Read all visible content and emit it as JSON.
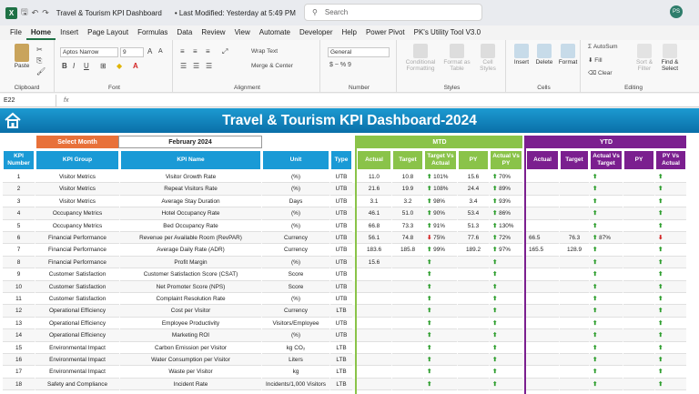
{
  "window": {
    "title": "Travel & Tourism KPI Dashboard",
    "modified": "• Last Modified: Yesterday at 5:49 PM",
    "search_placeholder": "Search",
    "user_initials": "PS"
  },
  "menu": [
    "File",
    "Home",
    "Insert",
    "Page Layout",
    "Formulas",
    "Data",
    "Review",
    "View",
    "Automate",
    "Developer",
    "Help",
    "Power Pivot",
    "PK's Utility Tool V3.0"
  ],
  "ribbon": {
    "clipboard": {
      "label": "Clipboard",
      "paste": "Paste"
    },
    "font": {
      "label": "Font",
      "family": "Aptos Narrow",
      "size": "9",
      "bold": "B",
      "italic": "I",
      "underline": "U"
    },
    "alignment": {
      "label": "Alignment",
      "wrap": "Wrap Text",
      "merge": "Merge & Center"
    },
    "number": {
      "label": "Number",
      "format": "General",
      "currency": "$ ~ % 9"
    },
    "styles": {
      "label": "Styles",
      "cond": "Conditional Formatting",
      "table": "Format as Table",
      "cell": "Cell Styles"
    },
    "cells": {
      "label": "Cells",
      "insert": "Insert",
      "delete": "Delete",
      "format": "Format"
    },
    "editing": {
      "label": "Editing",
      "autosum": "AutoSum",
      "fill": "Fill",
      "clear": "Clear",
      "sort": "Sort & Filter",
      "find": "Find & Select"
    }
  },
  "namebox": "E22",
  "fx": "fx",
  "dashboard": {
    "title": "Travel & Tourism KPI Dashboard-2024",
    "select_month_label": "Select Month",
    "selected_month": "February 2024",
    "mtd_label": "MTD",
    "ytd_label": "YTD",
    "colors": {
      "banner": "#1689c6",
      "blue": "#1a9ad6",
      "green": "#8ac349",
      "purple": "#7b1f8f",
      "orange": "#e8713a"
    },
    "headers": {
      "num": "KPI Number",
      "group": "KPI Group",
      "name": "KPI Name",
      "unit": "Unit",
      "type": "Type",
      "mtd": [
        "Actual",
        "Target",
        "Target Vs Actual",
        "PY",
        "Actual Vs PY"
      ],
      "ytd": [
        "Actual",
        "Target",
        "Actual Vs Target",
        "PY",
        "PY Vs Actual"
      ]
    },
    "rows": [
      {
        "n": "1",
        "g": "Visitor Metrics",
        "k": "Visitor Growth Rate",
        "u": "(%)",
        "t": "UTB",
        "ma": "11.0",
        "mt": "10.8",
        "mtv": "101%",
        "mtvd": "up",
        "mp": "15.6",
        "map": "70%",
        "mapd": "up",
        "ya": "",
        "yt": "",
        "yav": "",
        "yavd": "up",
        "yp": "",
        "ypa": "",
        "ypad": "up"
      },
      {
        "n": "2",
        "g": "Visitor Metrics",
        "k": "Repeat Visitors Rate",
        "u": "(%)",
        "t": "UTB",
        "ma": "21.6",
        "mt": "19.9",
        "mtv": "108%",
        "mtvd": "up",
        "mp": "24.4",
        "map": "89%",
        "mapd": "up",
        "ya": "",
        "yt": "",
        "yav": "",
        "yavd": "up",
        "yp": "",
        "ypa": "",
        "ypad": "up"
      },
      {
        "n": "3",
        "g": "Visitor Metrics",
        "k": "Average Stay Duration",
        "u": "Days",
        "t": "UTB",
        "ma": "3.1",
        "mt": "3.2",
        "mtv": "98%",
        "mtvd": "up",
        "mp": "3.4",
        "map": "93%",
        "mapd": "up",
        "ya": "",
        "yt": "",
        "yav": "",
        "yavd": "up",
        "yp": "",
        "ypa": "",
        "ypad": "up"
      },
      {
        "n": "4",
        "g": "Occupancy Metrics",
        "k": "Hotel Occupancy Rate",
        "u": "(%)",
        "t": "UTB",
        "ma": "46.1",
        "mt": "51.0",
        "mtv": "90%",
        "mtvd": "up",
        "mp": "53.4",
        "map": "86%",
        "mapd": "up",
        "ya": "",
        "yt": "",
        "yav": "",
        "yavd": "up",
        "yp": "",
        "ypa": "",
        "ypad": "up"
      },
      {
        "n": "5",
        "g": "Occupancy Metrics",
        "k": "Bed Occupancy Rate",
        "u": "(%)",
        "t": "UTB",
        "ma": "66.8",
        "mt": "73.3",
        "mtv": "91%",
        "mtvd": "up",
        "mp": "51.3",
        "map": "130%",
        "mapd": "up",
        "ya": "",
        "yt": "",
        "yav": "",
        "yavd": "up",
        "yp": "",
        "ypa": "",
        "ypad": "up"
      },
      {
        "n": "6",
        "g": "Financial Performance",
        "k": "Revenue per Available Room (RevPAR)",
        "u": "Currency",
        "t": "UTB",
        "ma": "56.1",
        "mt": "74.8",
        "mtv": "75%",
        "mtvd": "dn",
        "mp": "77.6",
        "map": "72%",
        "mapd": "up",
        "ya": "66.5",
        "yt": "76.3",
        "yav": "87%",
        "yavd": "up",
        "yp": "",
        "ypa": "",
        "ypad": "dn"
      },
      {
        "n": "7",
        "g": "Financial Performance",
        "k": "Average Daily Rate (ADR)",
        "u": "Currency",
        "t": "UTB",
        "ma": "183.6",
        "mt": "185.8",
        "mtv": "99%",
        "mtvd": "up",
        "mp": "189.2",
        "map": "97%",
        "mapd": "up",
        "ya": "165.5",
        "yt": "128.9",
        "yav": "",
        "yavd": "up",
        "yp": "",
        "ypa": "",
        "ypad": "up"
      },
      {
        "n": "8",
        "g": "Financial Performance",
        "k": "Profit Margin",
        "u": "(%)",
        "t": "UTB",
        "ma": "15.6",
        "mt": "",
        "mtv": "",
        "mtvd": "up",
        "mp": "",
        "map": "",
        "mapd": "up",
        "ya": "",
        "yt": "",
        "yav": "",
        "yavd": "up",
        "yp": "",
        "ypa": "",
        "ypad": "up"
      },
      {
        "n": "9",
        "g": "Customer Satisfaction",
        "k": "Customer Satisfaction Score (CSAT)",
        "u": "Score",
        "t": "UTB",
        "ma": "",
        "mt": "",
        "mtv": "",
        "mtvd": "up",
        "mp": "",
        "map": "",
        "mapd": "up",
        "ya": "",
        "yt": "",
        "yav": "",
        "yavd": "up",
        "yp": "",
        "ypa": "",
        "ypad": "up"
      },
      {
        "n": "10",
        "g": "Customer Satisfaction",
        "k": "Net Promoter Score (NPS)",
        "u": "Score",
        "t": "UTB",
        "ma": "",
        "mt": "",
        "mtv": "",
        "mtvd": "up",
        "mp": "",
        "map": "",
        "mapd": "up",
        "ya": "",
        "yt": "",
        "yav": "",
        "yavd": "up",
        "yp": "",
        "ypa": "",
        "ypad": "up"
      },
      {
        "n": "11",
        "g": "Customer Satisfaction",
        "k": "Complaint Resolution Rate",
        "u": "(%)",
        "t": "UTB",
        "ma": "",
        "mt": "",
        "mtv": "",
        "mtvd": "up",
        "mp": "",
        "map": "",
        "mapd": "up",
        "ya": "",
        "yt": "",
        "yav": "",
        "yavd": "up",
        "yp": "",
        "ypa": "",
        "ypad": "up"
      },
      {
        "n": "12",
        "g": "Operational Efficiency",
        "k": "Cost per Visitor",
        "u": "Currency",
        "t": "LTB",
        "ma": "",
        "mt": "",
        "mtv": "",
        "mtvd": "up",
        "mp": "",
        "map": "",
        "mapd": "up",
        "ya": "",
        "yt": "",
        "yav": "",
        "yavd": "up",
        "yp": "",
        "ypa": "",
        "ypad": "up"
      },
      {
        "n": "13",
        "g": "Operational Efficiency",
        "k": "Employee Productivity",
        "u": "Visitors/Employee",
        "t": "UTB",
        "ma": "",
        "mt": "",
        "mtv": "",
        "mtvd": "up",
        "mp": "",
        "map": "",
        "mapd": "up",
        "ya": "",
        "yt": "",
        "yav": "",
        "yavd": "up",
        "yp": "",
        "ypa": "",
        "ypad": "up"
      },
      {
        "n": "14",
        "g": "Operational Efficiency",
        "k": "Marketing ROI",
        "u": "(%)",
        "t": "UTB",
        "ma": "",
        "mt": "",
        "mtv": "",
        "mtvd": "up",
        "mp": "",
        "map": "",
        "mapd": "up",
        "ya": "",
        "yt": "",
        "yav": "",
        "yavd": "up",
        "yp": "",
        "ypa": "",
        "ypad": "up"
      },
      {
        "n": "15",
        "g": "Environmental Impact",
        "k": "Carbon Emission per Visitor",
        "u": "kg CO₂",
        "t": "LTB",
        "ma": "",
        "mt": "",
        "mtv": "",
        "mtvd": "up",
        "mp": "",
        "map": "",
        "mapd": "up",
        "ya": "",
        "yt": "",
        "yav": "",
        "yavd": "up",
        "yp": "",
        "ypa": "",
        "ypad": "up"
      },
      {
        "n": "16",
        "g": "Environmental Impact",
        "k": "Water Consumption per Visitor",
        "u": "Liters",
        "t": "LTB",
        "ma": "",
        "mt": "",
        "mtv": "",
        "mtvd": "up",
        "mp": "",
        "map": "",
        "mapd": "up",
        "ya": "",
        "yt": "",
        "yav": "",
        "yavd": "up",
        "yp": "",
        "ypa": "",
        "ypad": "up"
      },
      {
        "n": "17",
        "g": "Environmental Impact",
        "k": "Waste per Visitor",
        "u": "kg",
        "t": "LTB",
        "ma": "",
        "mt": "",
        "mtv": "",
        "mtvd": "up",
        "mp": "",
        "map": "",
        "mapd": "up",
        "ya": "",
        "yt": "",
        "yav": "",
        "yavd": "up",
        "yp": "",
        "ypa": "",
        "ypad": "up"
      },
      {
        "n": "18",
        "g": "Safety and Compliance",
        "k": "Incident Rate",
        "u": "Incidents/1,000 Visitors",
        "t": "LTB",
        "ma": "",
        "mt": "",
        "mtv": "",
        "mtvd": "up",
        "mp": "",
        "map": "",
        "mapd": "up",
        "ya": "",
        "yt": "",
        "yav": "",
        "yavd": "up",
        "yp": "",
        "ypa": "",
        "ypad": "up"
      }
    ]
  }
}
